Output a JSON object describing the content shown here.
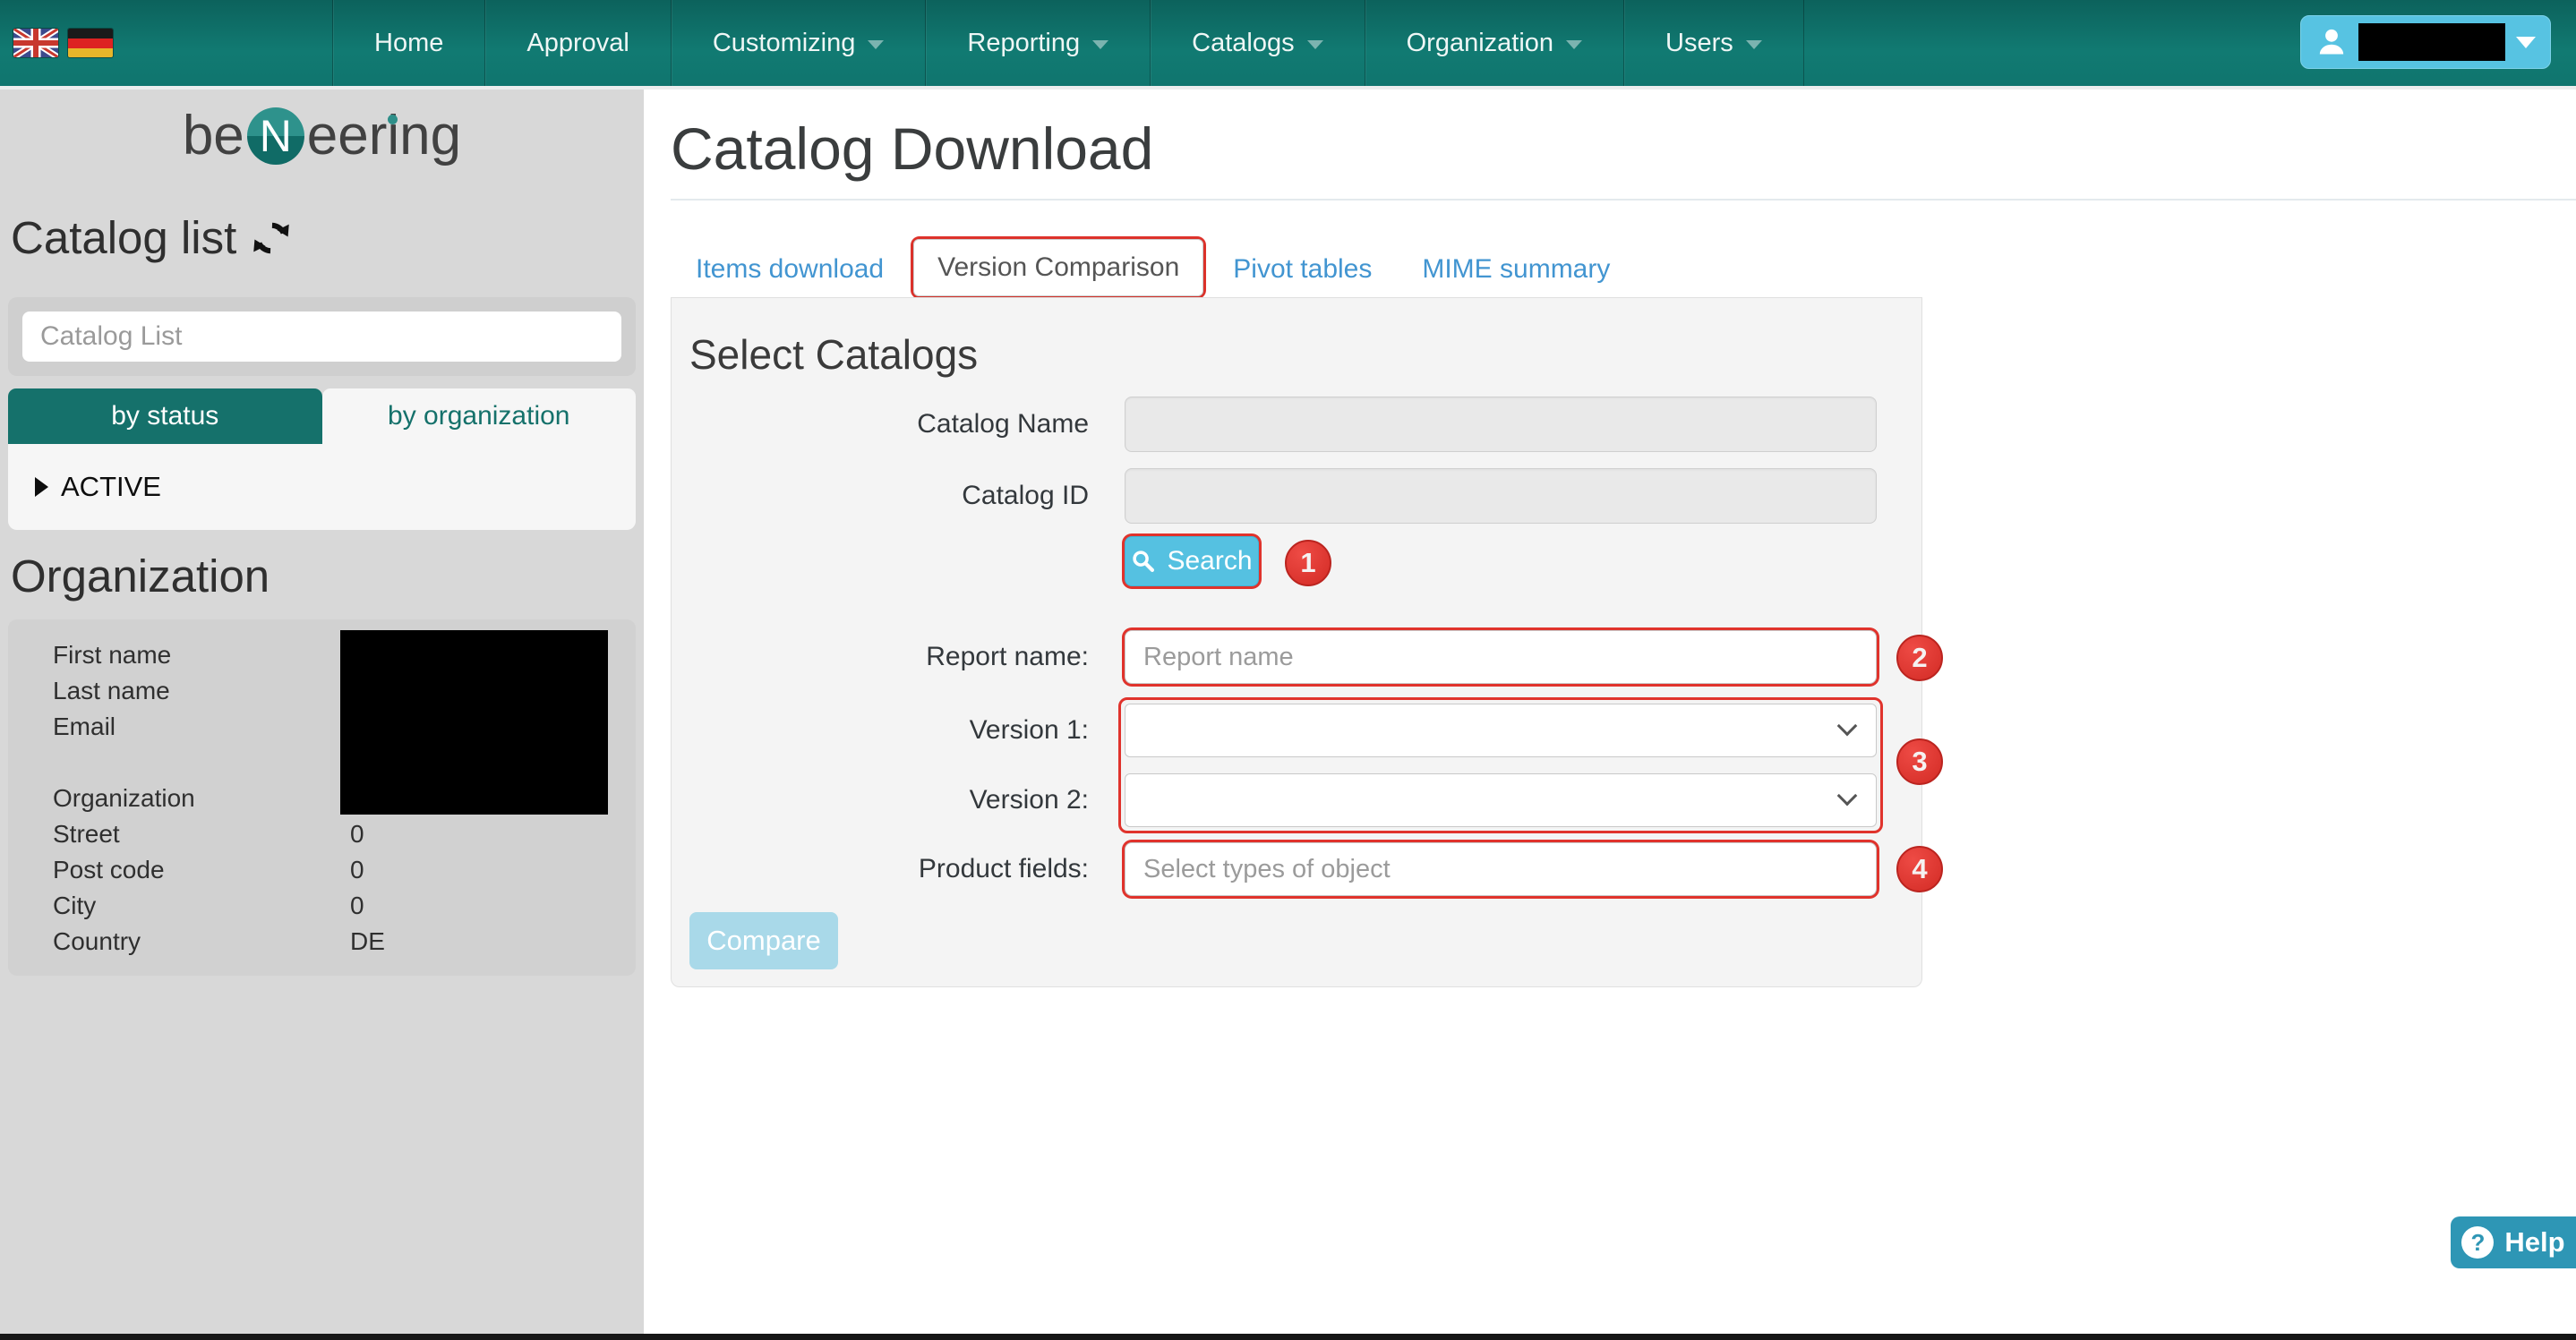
{
  "nav": {
    "items": [
      {
        "label": "Home",
        "caret": false
      },
      {
        "label": "Approval",
        "caret": false
      },
      {
        "label": "Customizing",
        "caret": true
      },
      {
        "label": "Reporting",
        "caret": true
      },
      {
        "label": "Catalogs",
        "caret": true
      },
      {
        "label": "Organization",
        "caret": true
      },
      {
        "label": "Users",
        "caret": true
      }
    ],
    "flags": [
      "uk-flag",
      "german-flag"
    ],
    "user_name_redacted": true
  },
  "sidebar": {
    "logo": {
      "left": "be",
      "circle": "N",
      "right": "eering"
    },
    "catalog_list": {
      "title": "Catalog list",
      "search_placeholder": "Catalog List",
      "tabs": [
        {
          "label": "by status",
          "active": true
        },
        {
          "label": "by organization",
          "active": false
        }
      ],
      "groups": [
        {
          "label": "ACTIVE"
        }
      ]
    },
    "organization": {
      "title": "Organization",
      "rows": [
        {
          "label": "First name",
          "value": ""
        },
        {
          "label": "Last name",
          "value": ""
        },
        {
          "label": "Email",
          "value": ""
        },
        {
          "label": "Organization",
          "value": ""
        },
        {
          "label": "Street",
          "value": "0"
        },
        {
          "label": "Post code",
          "value": "0"
        },
        {
          "label": "City",
          "value": "0"
        },
        {
          "label": "Country",
          "value": "DE"
        }
      ]
    }
  },
  "main": {
    "title": "Catalog Download",
    "tabs": [
      {
        "label": "Items download",
        "active": false
      },
      {
        "label": "Version Comparison",
        "active": true
      },
      {
        "label": "Pivot tables",
        "active": false
      },
      {
        "label": "MIME summary",
        "active": false
      }
    ],
    "form": {
      "section_title": "Select Catalogs",
      "catalog_name_label": "Catalog Name",
      "catalog_id_label": "Catalog ID",
      "search_button": "Search",
      "report_label": "Report name:",
      "report_placeholder": "Report name",
      "version1_label": "Version 1:",
      "version2_label": "Version 2:",
      "product_label": "Product fields:",
      "product_placeholder": "Select types of object",
      "compare_button": "Compare"
    },
    "annotations": {
      "search": "1",
      "report": "2",
      "versions": "3",
      "product": "4"
    }
  },
  "help": {
    "label": "Help",
    "question_glyph": "?"
  },
  "colors": {
    "nav_teal": "#11736d",
    "sidebar_gray": "#d8d8d8",
    "link_blue": "#4295d1",
    "search_blue": "#55c1e1",
    "compare_disabled_blue": "#a9d9e9",
    "annotation_red": "#e0332c",
    "help_blue": "#2e96b5"
  }
}
